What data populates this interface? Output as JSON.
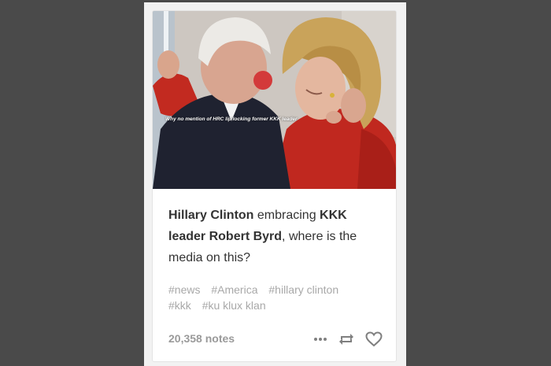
{
  "post": {
    "image_caption": "Why no mention of HRC lip locking former KKK leader",
    "body": {
      "part1_bold": "Hillary Clinton",
      "part2": " embracing ",
      "part3_bold": "KKK leader Robert Byrd",
      "part4": ", where is the media on this?"
    },
    "tags": [
      "#news",
      "#America",
      "#hillary clinton",
      "#kkk",
      "#ku klux klan"
    ],
    "notes": "20,358 notes",
    "icons": {
      "more": "more-dots-icon",
      "reblog": "reblog-icon",
      "like": "heart-icon"
    },
    "colors": {
      "background": "#4a4a4a",
      "card": "#ffffff",
      "meta_text": "#a8a8a8",
      "body_text": "#333333"
    }
  }
}
